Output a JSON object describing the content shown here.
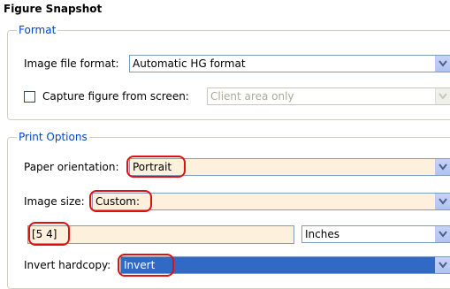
{
  "window": {
    "title": "Figure Snapshot"
  },
  "format": {
    "group_label": "Format",
    "image_file_format": {
      "label": "Image file format:",
      "value": "Automatic HG format"
    },
    "capture": {
      "label": "Capture figure from screen:",
      "checked": false,
      "option": "Client area only"
    }
  },
  "print_options": {
    "group_label": "Print Options",
    "paper_orientation": {
      "label": "Paper orientation:",
      "value": "Portrait"
    },
    "image_size": {
      "label": "Image size:",
      "value": "Custom:"
    },
    "size_values": "[5 4]",
    "units": "Inches",
    "invert_hardcopy": {
      "label": "Invert hardcopy:",
      "value": "Invert"
    }
  },
  "colors": {
    "accent": "#0046d5",
    "highlight": "#e01010",
    "field_bg": "#fdf0dd",
    "selection": "#316ac5"
  }
}
